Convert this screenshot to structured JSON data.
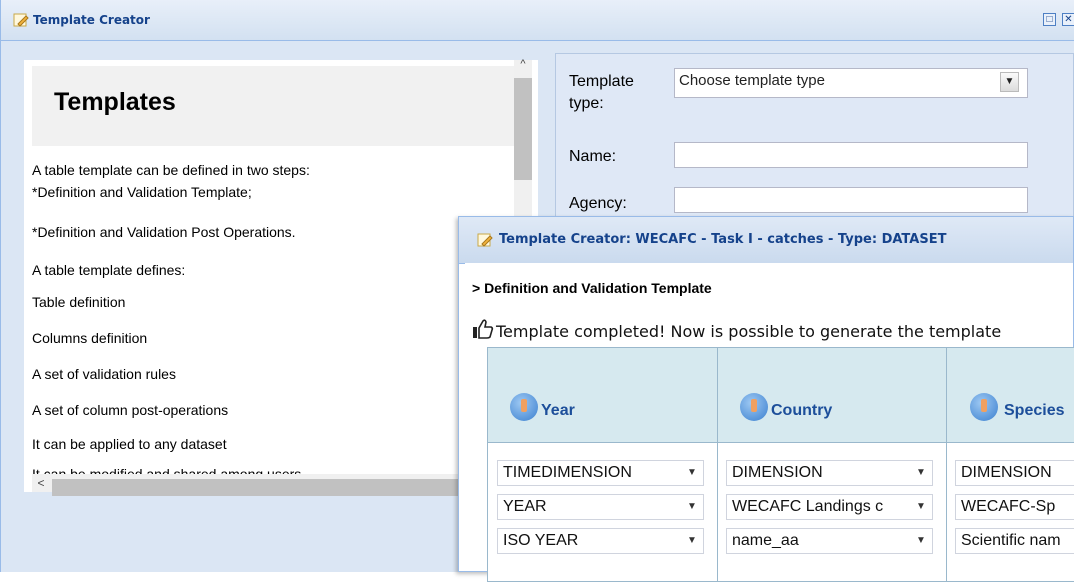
{
  "main_window": {
    "title": "Template Creator",
    "maximize_glyph": "□",
    "close_glyph": "✕"
  },
  "help": {
    "heading": "Templates",
    "lines": [
      "A table template can be defined in two steps:",
      "*Definition and Validation Template;",
      "*Definition and Validation Post Operations.",
      "A table template defines:",
      "Table definition",
      "Columns definition",
      "A set of validation rules",
      "A set of column post-operations",
      "It can be applied to any dataset",
      "It can be modified and shared among users"
    ]
  },
  "form": {
    "template_type_label_1": "Template",
    "template_type_label_2": "type:",
    "template_type_value": "Choose template type",
    "name_label": "Name:",
    "agency_label": "Agency:"
  },
  "modal": {
    "title": "Template Creator: WECAFC - Task I - catches - Type: DATASET",
    "section": "> Definition and Validation Template",
    "completed_message": "Template completed! Now is possible to generate the template",
    "columns": [
      {
        "name": "Year",
        "type": "TIMEDIMENSION",
        "codelist": "YEAR",
        "attribute": "ISO YEAR"
      },
      {
        "name": "Country",
        "type": "DIMENSION",
        "codelist": "WECAFC Landings c",
        "attribute": "name_aa"
      },
      {
        "name": "Species",
        "type": "DIMENSION",
        "codelist": "WECAFC-Sp",
        "attribute": "Scientific nam"
      }
    ]
  },
  "colors": {
    "title_text": "#15428b",
    "column_header_bg": "#d6e9ef",
    "column_title": "#1c4e9a"
  },
  "icons": {
    "window_icon": "pencil-document-icon",
    "thumb_icon": "thumbs-up-icon",
    "column_icon": "pencil-badge-icon"
  }
}
